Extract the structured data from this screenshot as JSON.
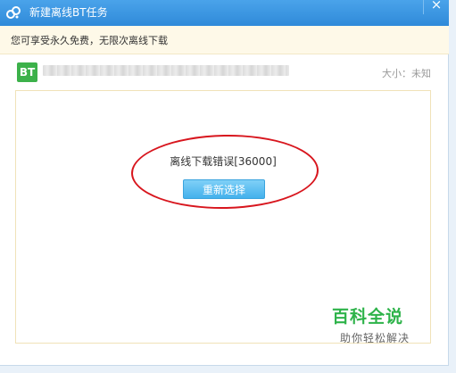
{
  "window": {
    "title": "新建离线BT任务",
    "close_label": "×",
    "logo_icon": "cloud-logo-icon"
  },
  "notice": {
    "text": "您可享受永久免费，无限次离线下载"
  },
  "file": {
    "badge": "BT",
    "name": "",
    "size_label": "大小：未知"
  },
  "content": {
    "error_message": "离线下载错误[36000]",
    "retry_label": "重新选择"
  },
  "watermark": {
    "title": "百科全说",
    "subtitle": "助你轻松解决"
  },
  "colors": {
    "titlebar": "#2f8ad9",
    "button": "#43b1ec",
    "highlight": "#d8161e",
    "watermark": "#2eb34a"
  }
}
